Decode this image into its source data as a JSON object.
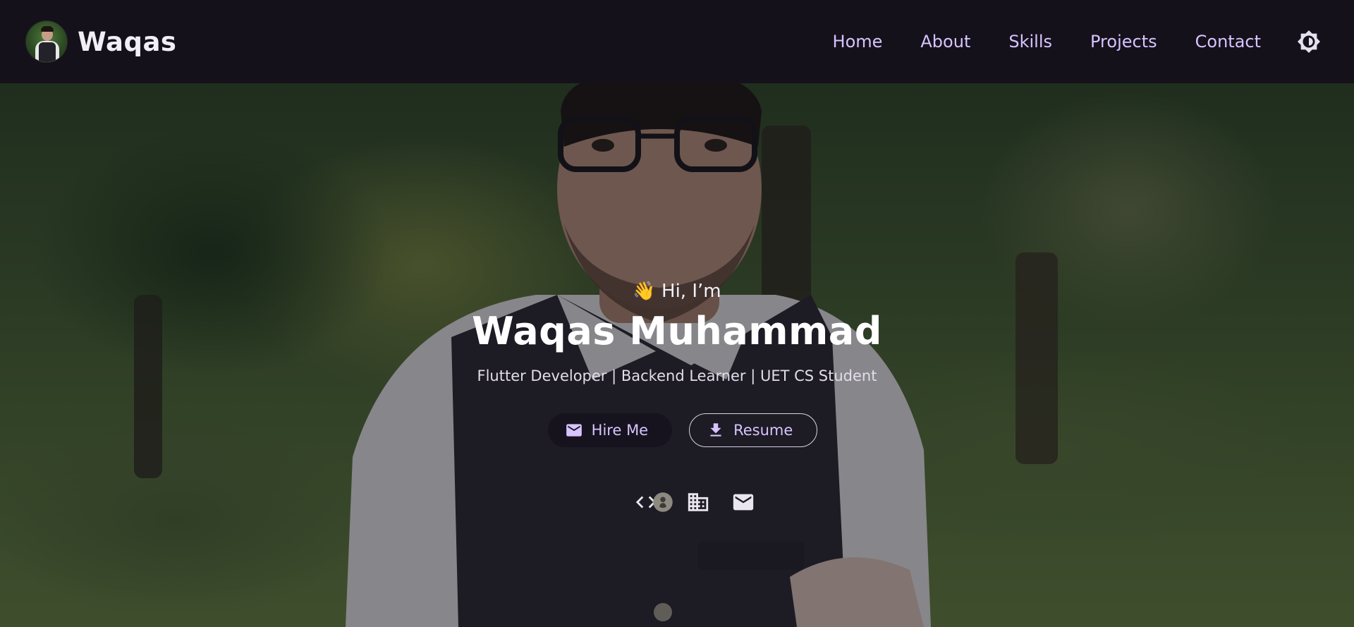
{
  "brand": {
    "name": "Waqas"
  },
  "nav": {
    "links": [
      {
        "label": "Home"
      },
      {
        "label": "About"
      },
      {
        "label": "Skills"
      },
      {
        "label": "Projects"
      },
      {
        "label": "Contact"
      }
    ],
    "theme_toggle_icon": "brightness-icon"
  },
  "hero": {
    "greeting": "👋 Hi, I’m",
    "name": "Waqas Muhammad",
    "tagline": "Flutter Developer | Backend Learner | UET CS Student",
    "buttons": {
      "hire": {
        "label": "Hire Me",
        "icon": "mail-icon"
      },
      "resume": {
        "label": "Resume",
        "icon": "download-icon"
      }
    },
    "social": [
      {
        "icon": "code-icon"
      },
      {
        "icon": "github-icon"
      },
      {
        "icon": "building-icon"
      },
      {
        "icon": "mail-icon"
      }
    ]
  },
  "colors": {
    "nav_bg": "#14111b",
    "accent": "#d7c4ff",
    "text": "#ffffff"
  }
}
